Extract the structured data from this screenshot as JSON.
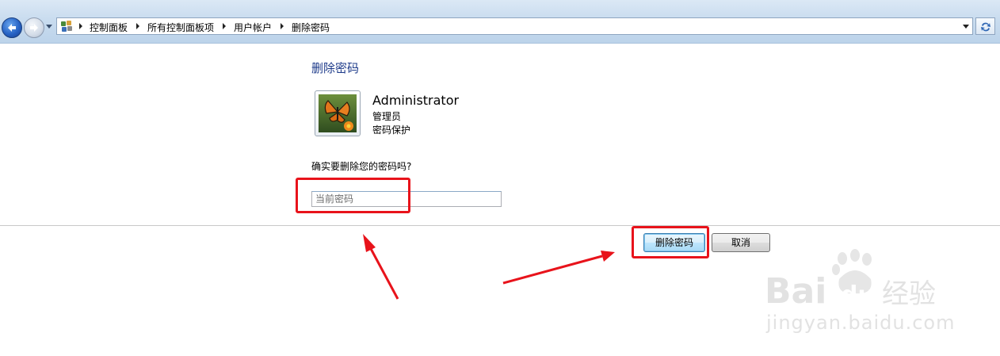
{
  "address_bar": {
    "breadcrumbs": [
      "控制面板",
      "所有控制面板项",
      "用户帐户",
      "删除密码"
    ]
  },
  "page": {
    "title": "删除密码",
    "user_name": "Administrator",
    "user_role": "管理员",
    "user_status": "密码保护",
    "question": "确实要删除您的密码吗?"
  },
  "form": {
    "password_placeholder": "当前密码",
    "password_value": ""
  },
  "buttons": {
    "delete": "删除密码",
    "cancel": "取消"
  },
  "watermark": {
    "logo_text": "Bai du 经验",
    "url": "jingyan.baidu.com"
  },
  "colors": {
    "title_blue": "#1e3b8a",
    "annotation_red": "#e8131b",
    "address_bar_bg": "#c9dcef"
  },
  "icons": {
    "back": "back-arrow-icon",
    "forward": "forward-arrow-icon",
    "control_panel": "control-panel-icon",
    "refresh": "refresh-icon",
    "avatar": "butterfly-avatar"
  }
}
